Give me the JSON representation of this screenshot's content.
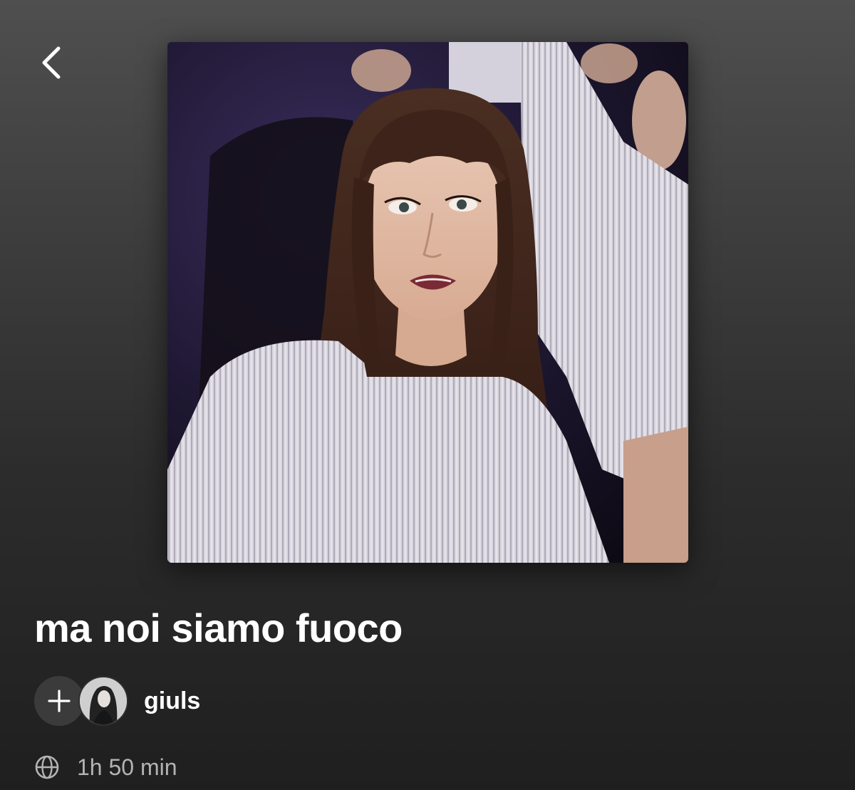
{
  "header": {
    "back_icon": "chevron-left-icon"
  },
  "cover": {
    "description_icon": "playlist-cover-image"
  },
  "playlist": {
    "title": "ma noi siamo fuoco",
    "owner": "giuls",
    "duration": "1h 50 min",
    "visibility_icon": "globe-icon",
    "add_icon": "plus-icon"
  },
  "colors": {
    "background_top": "#4f4f4f",
    "background_bottom": "#1f1f1f",
    "text_primary": "#ffffff",
    "text_secondary": "#b3b3b3",
    "button_bg": "#3b3b3b"
  }
}
